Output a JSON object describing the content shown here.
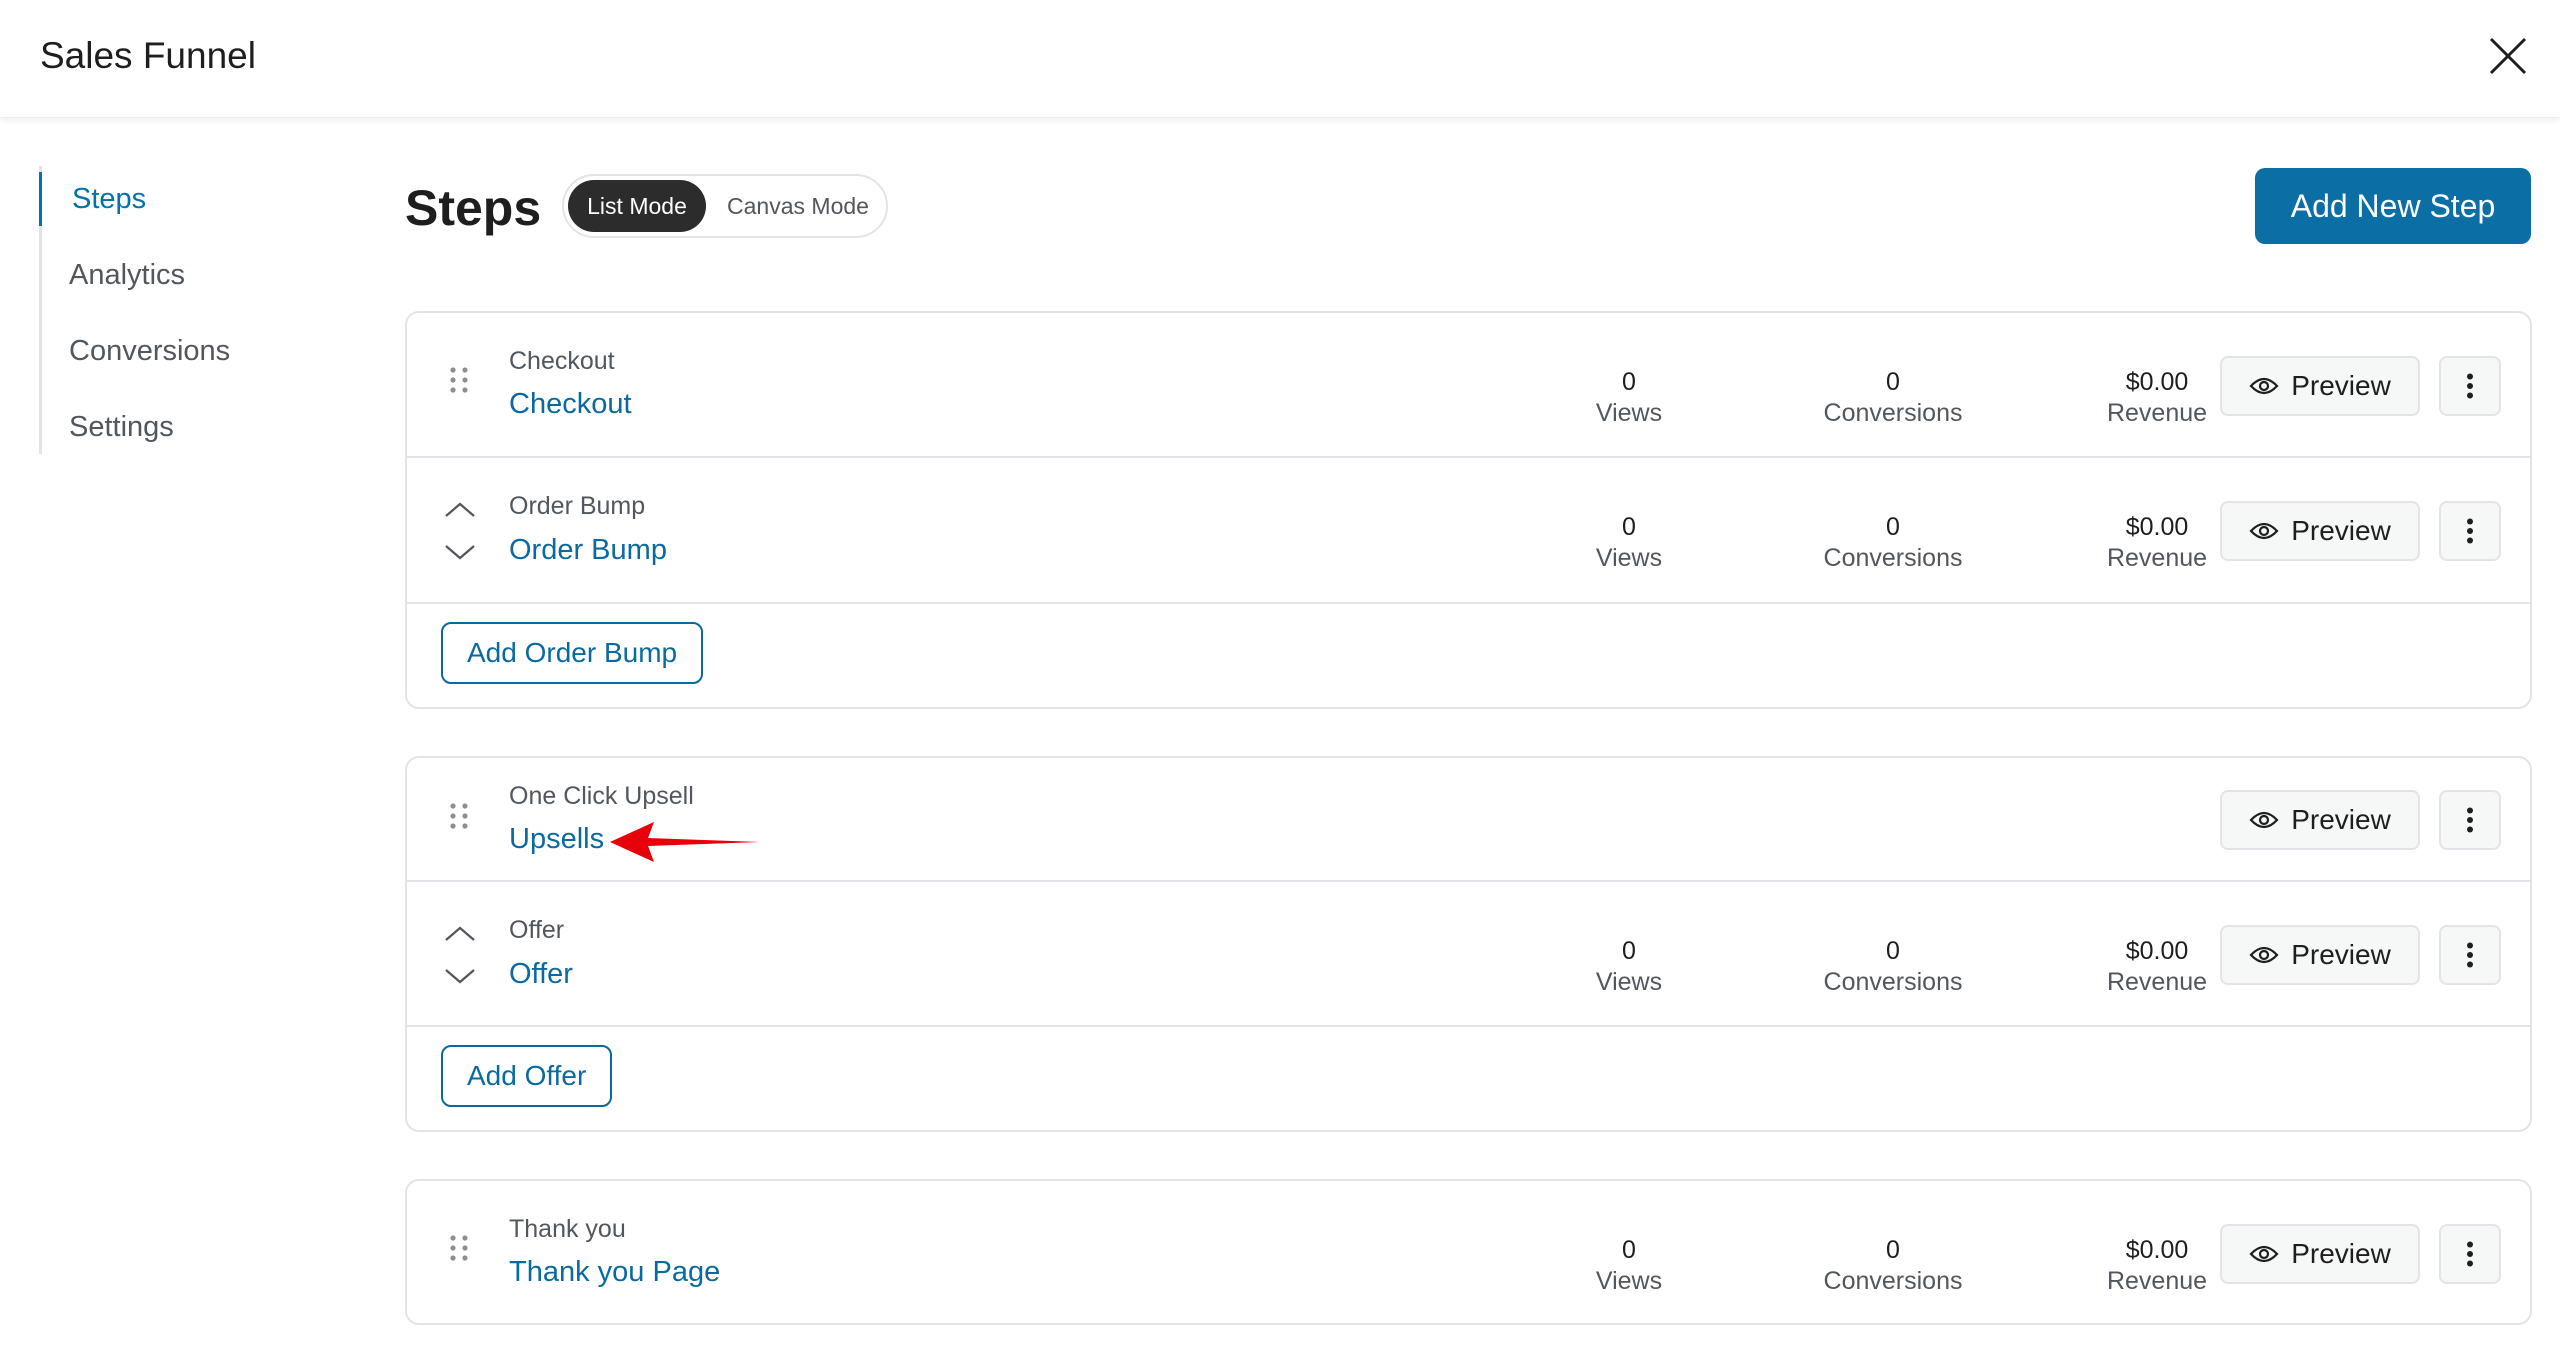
{
  "header": {
    "title": "Sales Funnel"
  },
  "sidebar": {
    "items": [
      {
        "label": "Steps",
        "active": true
      },
      {
        "label": "Analytics",
        "active": false
      },
      {
        "label": "Conversions",
        "active": false
      },
      {
        "label": "Settings",
        "active": false
      }
    ]
  },
  "main": {
    "title": "Steps",
    "modes": {
      "list": "List Mode",
      "canvas": "Canvas Mode",
      "selected": "List Mode"
    },
    "add_step_label": "Add New Step"
  },
  "labels": {
    "views": "Views",
    "conversions": "Conversions",
    "revenue": "Revenue",
    "preview": "Preview"
  },
  "groups": [
    {
      "step": {
        "type": "Checkout",
        "name": "Checkout",
        "views": "0",
        "conversions": "0",
        "revenue": "$0.00"
      },
      "sub": {
        "type": "Order Bump",
        "name": "Order Bump",
        "views": "0",
        "conversions": "0",
        "revenue": "$0.00"
      },
      "add_label": "Add Order Bump"
    },
    {
      "step": {
        "type": "One Click Upsell",
        "name": "Upsells"
      },
      "sub": {
        "type": "Offer",
        "name": "Offer",
        "views": "0",
        "conversions": "0",
        "revenue": "$0.00"
      },
      "add_label": "Add Offer"
    },
    {
      "step": {
        "type": "Thank you",
        "name": "Thank you Page",
        "views": "0",
        "conversions": "0",
        "revenue": "$0.00"
      }
    }
  ],
  "colors": {
    "accent": "#0a6aa0",
    "primary_button": "#0b6fa6",
    "annotation_arrow": "#e8000b"
  },
  "icons": {
    "close": "close-icon",
    "drag": "drag-handle-icon",
    "reorder_up": "chevron-up-icon",
    "reorder_down": "chevron-down-icon",
    "preview": "eye-icon",
    "more": "more-vertical-icon"
  }
}
